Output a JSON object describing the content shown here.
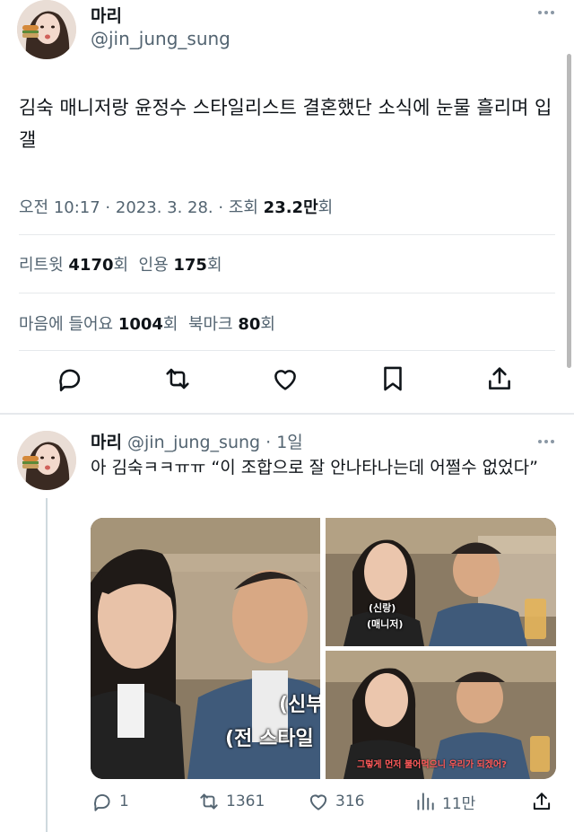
{
  "main_tweet": {
    "display_name": "마리",
    "handle": "@jin_jung_sung",
    "text": "김숙 매니저랑 윤정수 스타일리스트 결혼했단 소식에 눈물 흘리며 입갤",
    "timestamp": "오전 10:17 · 2023. 3. 28. · 조회 ",
    "views": "23.2만",
    "views_suffix": "회",
    "retweets_label": "리트윗 ",
    "retweets": "4170",
    "retweets_suffix": "회",
    "quotes_label": "인용 ",
    "quotes": "175",
    "quotes_suffix": "회",
    "likes_label": "마음에 들어요 ",
    "likes": "1004",
    "likes_suffix": "회",
    "bookmarks_label": "북마크 ",
    "bookmarks": "80",
    "bookmarks_suffix": "회",
    "actions": [
      "reply-icon",
      "retweet-icon",
      "like-icon",
      "bookmark-icon",
      "share-icon"
    ]
  },
  "reply_tweet": {
    "display_name": "마리",
    "handle": "@jin_jung_sung",
    "time_sep": " · ",
    "time": "1일",
    "text": "아 김숙ㅋㅋㅠㅠ “이 조합으로 잘 안나타나는데 어쩔수 없었다”",
    "captions": {
      "left_line1": "(신부",
      "left_line2": "(전 스타일",
      "top_right_line1": "(신랑)",
      "top_right_line2": "(매니저)",
      "bottom_right": "그렇게 먼저 불어먹으니 우리가 되겠어?"
    },
    "replies": "1",
    "retweets": "1361",
    "likes": "316",
    "views": "11만"
  },
  "colors": {
    "text": "#0f1419",
    "secondary": "#536471",
    "divider": "#e6e9ec",
    "caption_red": "#ff5a5a"
  }
}
